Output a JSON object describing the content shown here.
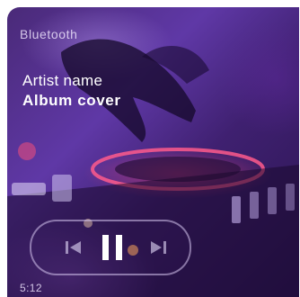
{
  "status": {
    "connection_label": "Bluetooth"
  },
  "track": {
    "artist": "Artist name",
    "album": "Album cover"
  },
  "player": {
    "elapsed": "5:12",
    "state": "playing"
  },
  "icons": {
    "previous": "skip-previous-icon",
    "pause": "pause-icon",
    "next": "skip-next-icon"
  },
  "colors": {
    "background": "#4a2a78",
    "accent_glow": "#ff4678",
    "control_border": "#d7c8f0",
    "text": "#ffffff"
  }
}
